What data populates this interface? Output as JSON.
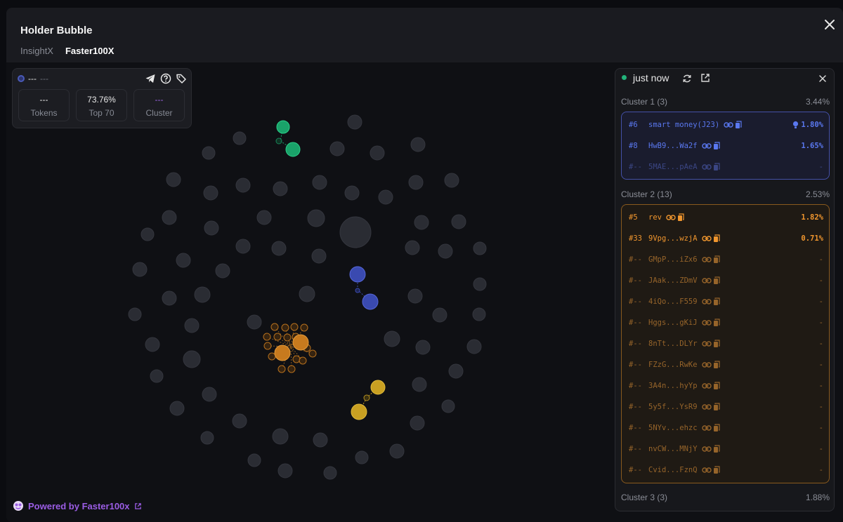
{
  "header": {
    "title": "Holder Bubble",
    "tabs": [
      {
        "label": "InsightX",
        "active": false
      },
      {
        "label": "Faster100X",
        "active": true
      }
    ]
  },
  "token": {
    "name": "---",
    "symbol": "---",
    "stats": [
      {
        "value": "---",
        "label": "Tokens"
      },
      {
        "value": "73.76%",
        "label": "Top 70"
      },
      {
        "value": "---",
        "label": "Cluster"
      }
    ]
  },
  "powered_by": {
    "prefix": "Powered by ",
    "brand": "Faster100x"
  },
  "panel": {
    "status": "just now",
    "clusters": [
      {
        "label": "Cluster 1 (3)",
        "pct": "3.44%",
        "items": [
          {
            "rank": "#6",
            "addr": "smart money(J23)",
            "pct": "1.80%",
            "bulb": true,
            "dim": false
          },
          {
            "rank": "#8",
            "addr": "HwB9...Wa2f",
            "pct": "1.65%",
            "bulb": false,
            "dim": false
          },
          {
            "rank": "#--",
            "addr": "5MAE...pAeA",
            "pct": "-",
            "bulb": false,
            "dim": true
          }
        ]
      },
      {
        "label": "Cluster 2 (13)",
        "pct": "2.53%",
        "items": [
          {
            "rank": "#5",
            "addr": "rev",
            "pct": "1.82%",
            "dim": false
          },
          {
            "rank": "#33",
            "addr": "9Vpg...wzjA",
            "pct": "0.71%",
            "dim": false
          },
          {
            "rank": "#--",
            "addr": "GMpP...iZx6",
            "pct": "-",
            "dim": true
          },
          {
            "rank": "#--",
            "addr": "JAak...ZDmV",
            "pct": "-",
            "dim": true
          },
          {
            "rank": "#--",
            "addr": "4iQo...F559",
            "pct": "-",
            "dim": true
          },
          {
            "rank": "#--",
            "addr": "Hggs...gKiJ",
            "pct": "-",
            "dim": true
          },
          {
            "rank": "#--",
            "addr": "8nTt...DLYr",
            "pct": "-",
            "dim": true
          },
          {
            "rank": "#--",
            "addr": "FZzG...RwKe",
            "pct": "-",
            "dim": true
          },
          {
            "rank": "#--",
            "addr": "3A4n...hyYp",
            "pct": "-",
            "dim": true
          },
          {
            "rank": "#--",
            "addr": "5y5f...YsR9",
            "pct": "-",
            "dim": true
          },
          {
            "rank": "#--",
            "addr": "5NYv...ehzc",
            "pct": "-",
            "dim": true
          },
          {
            "rank": "#--",
            "addr": "nvCW...MNjY",
            "pct": "-",
            "dim": true
          },
          {
            "rank": "#--",
            "addr": "Cvid...FznQ",
            "pct": "-",
            "dim": true
          }
        ]
      },
      {
        "label": "Cluster 3 (3)",
        "pct": "1.88%",
        "items": []
      }
    ]
  },
  "colors": {
    "cluster1": "#4f6ae8",
    "cluster2": "#f0962e",
    "green": "#1aa36a",
    "blue": "#3a4ab0",
    "orange": "#c77a1e",
    "yellow": "#c9a022",
    "bubble": "#2a2c33"
  }
}
